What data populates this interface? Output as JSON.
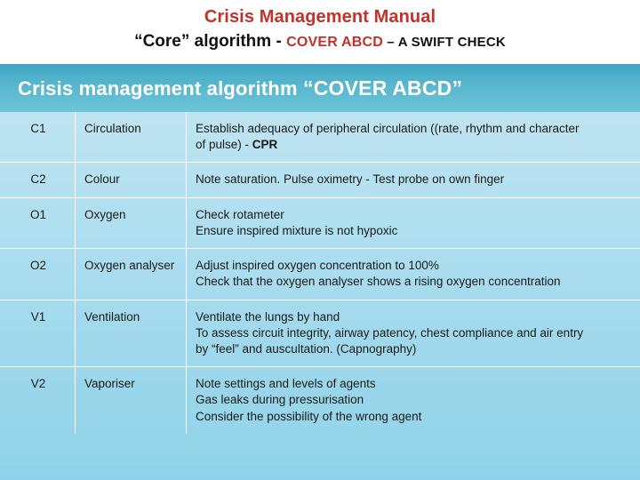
{
  "header": {
    "title": "Crisis Management Manual",
    "subtitle_core": "“Core” algorithm - ",
    "subtitle_cover": "COVER ABCD",
    "subtitle_dash": " – ",
    "subtitle_swift": "A SWIFT CHECK"
  },
  "banner": {
    "label_plain": "Crisis management algorithm ",
    "label_quoted": " “COVER ABCD”"
  },
  "table": {
    "rows": [
      {
        "code": "C1",
        "name": "Circulation",
        "lines": [
          "Establish adequacy of peripheral circulation ((rate, rhythm and character",
          "of pulse) - "
        ],
        "bold_tail": "CPR"
      },
      {
        "code": "C2",
        "name": "Colour",
        "lines": [
          "Note saturation. Pulse oximetry - Test probe on own finger"
        ],
        "bold_tail": ""
      },
      {
        "code": "O1",
        "name": "Oxygen",
        "lines": [
          "Check rotameter",
          "Ensure inspired mixture is not hypoxic"
        ],
        "bold_tail": ""
      },
      {
        "code": "O2",
        "name": "Oxygen analyser",
        "lines": [
          "Adjust inspired oxygen concentration to 100%",
          "Check that the oxygen analyser shows a rising oxygen concentration"
        ],
        "bold_tail": ""
      },
      {
        "code": "V1",
        "name": "Ventilation",
        "lines": [
          "Ventilate the lungs by hand",
          "To assess circuit integrity, airway patency, chest compliance and air entry",
          "by “feel” and auscultation. (Capnography)"
        ],
        "bold_tail": ""
      },
      {
        "code": "V2",
        "name": "Vaporiser",
        "lines": [
          "Note settings and levels of agents",
          "Gas leaks during pressurisation",
          "Consider the possibility of the wrong agent"
        ],
        "bold_tail": ""
      }
    ]
  }
}
